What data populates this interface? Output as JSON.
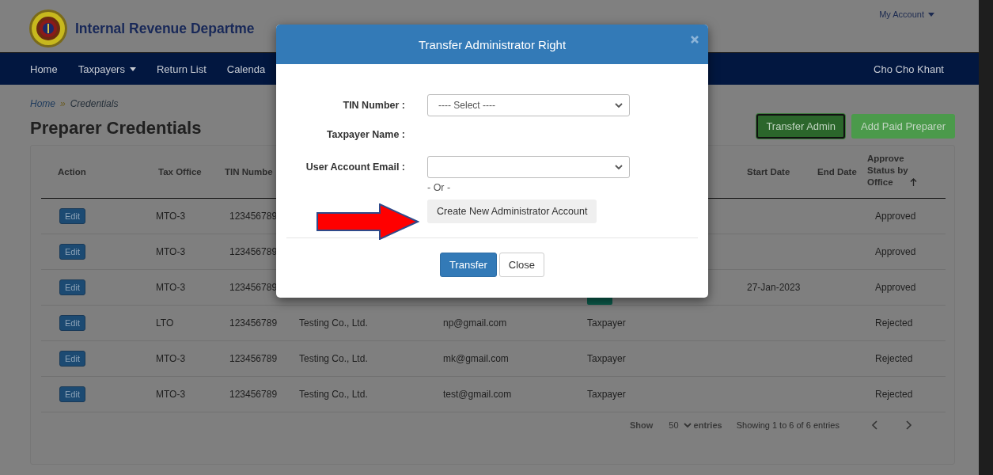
{
  "header": {
    "title": "Internal Revenue Departme",
    "account_menu": "My Account"
  },
  "nav": {
    "items": [
      {
        "label": "Home",
        "dropdown": false
      },
      {
        "label": "Taxpayers",
        "dropdown": true
      },
      {
        "label": "Return List",
        "dropdown": false
      },
      {
        "label": "Calenda",
        "dropdown": false
      }
    ],
    "user": "Cho Cho Khant"
  },
  "breadcrumb": [
    "Home",
    "»",
    "Credentials"
  ],
  "page_title": "Preparer Credentials",
  "actions": [
    {
      "label": "Transfer Admin",
      "focused": true
    },
    {
      "label": "Add Paid Preparer",
      "focused": false
    }
  ],
  "table": {
    "columns": [
      "Action",
      "Tax Office",
      "TIN Numbe",
      "",
      "",
      "",
      "",
      "Start Date",
      "End Date",
      "Approve Status by Office"
    ],
    "sort_ascending": true,
    "rows": [
      {
        "cells": [
          "Edit",
          "MTO-3",
          "123456789",
          "",
          "",
          "",
          "",
          "",
          "",
          "Approved"
        ],
        "badge": false
      },
      {
        "cells": [
          "Edit",
          "MTO-3",
          "123456789",
          "",
          "",
          "",
          "",
          "",
          "",
          "Approved"
        ],
        "badge": false
      },
      {
        "cells": [
          "Edit",
          "MTO-3",
          "123456789",
          "",
          "",
          "",
          "",
          "27-Jan-2023",
          "",
          "Approved"
        ],
        "badge": true
      },
      {
        "cells": [
          "Edit",
          "LTO",
          "123456789",
          "Testing Co., Ltd.",
          "np@gmail.com",
          "Taxpayer",
          "",
          "",
          "",
          "Rejected"
        ],
        "badge": false
      },
      {
        "cells": [
          "Edit",
          "MTO-3",
          "123456789",
          "Testing Co., Ltd.",
          "mk@gmail.com",
          "Taxpayer",
          "",
          "",
          "",
          "Rejected"
        ],
        "badge": false
      },
      {
        "cells": [
          "Edit",
          "MTO-3",
          "123456789",
          "Testing Co., Ltd.",
          "test@gmail.com",
          "Taxpayer",
          "",
          "",
          "",
          "Rejected"
        ],
        "badge": false
      }
    ]
  },
  "footer": {
    "show_label": "Show",
    "page_size": "50",
    "entries_label": "entries",
    "summary": "Showing 1 to 6 of 6 entries"
  },
  "modal": {
    "title": "Transfer Administrator Right",
    "fields": [
      {
        "label": "TIN Number :",
        "kind": "select",
        "value": "---- Select ----"
      },
      {
        "label": "Taxpayer Name :",
        "kind": "text"
      },
      {
        "label": "User Account Email :",
        "kind": "select"
      }
    ],
    "or_text": "- Or -",
    "create_button": "Create New Administrator Account",
    "buttons": [
      {
        "label": "Transfer",
        "kind": "primary"
      },
      {
        "label": "Close",
        "kind": "default"
      }
    ]
  }
}
